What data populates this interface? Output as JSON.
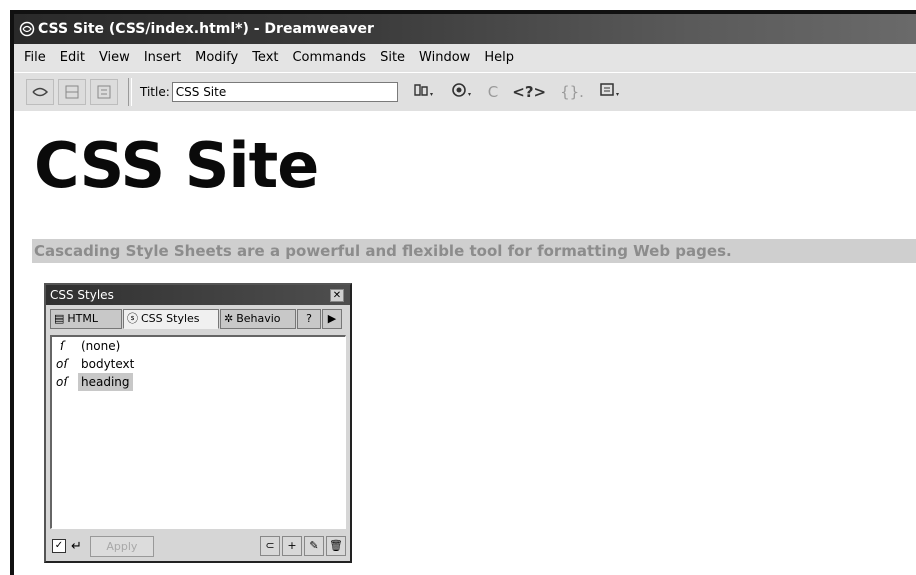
{
  "window": {
    "title": "CSS Site (CSS/index.html*) - Dreamweaver"
  },
  "menu": [
    "File",
    "Edit",
    "View",
    "Insert",
    "Modify",
    "Text",
    "Commands",
    "Site",
    "Window",
    "Help"
  ],
  "toolbar": {
    "title_label": "Title:",
    "title_value": "CSS Site",
    "icons": [
      "code-view-icon",
      "split-view-icon",
      "design-view-icon",
      "file-management-icon",
      "preview-browser-icon",
      "refresh-icon",
      "reference-icon",
      "code-nav-icon",
      "view-options-icon"
    ],
    "refresh_glyph": "C",
    "reference_glyph": "<?>",
    "code_nav_glyph": "{}."
  },
  "document": {
    "heading": "CSS Site",
    "body_text": "Cascading Style Sheets are a powerful and flexible tool for formatting Web pages."
  },
  "panel": {
    "title": "CSS Styles",
    "tabs": [
      "HTML",
      "CSS Styles",
      "Behavio"
    ],
    "styles": [
      {
        "label": "(none)",
        "selected": false
      },
      {
        "label": "bodytext",
        "selected": false
      },
      {
        "label": "heading",
        "selected": true
      }
    ],
    "apply_label": "Apply"
  }
}
